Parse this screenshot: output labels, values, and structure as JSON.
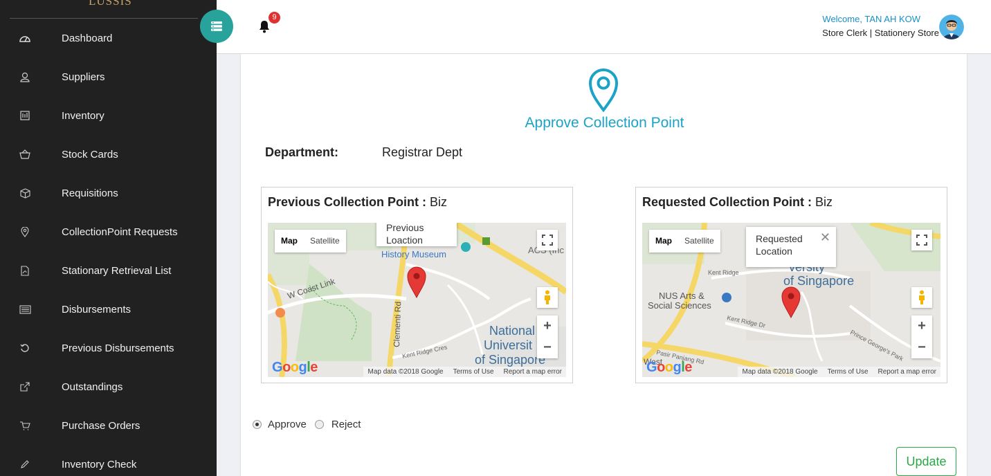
{
  "brand": "LUSSIS",
  "sidebar": {
    "items": [
      {
        "label": "Dashboard",
        "icon": "dashboard-icon"
      },
      {
        "label": "Suppliers",
        "icon": "user-icon"
      },
      {
        "label": "Inventory",
        "icon": "inventory-icon"
      },
      {
        "label": "Stock Cards",
        "icon": "basket-icon"
      },
      {
        "label": "Requisitions",
        "icon": "box-icon"
      },
      {
        "label": "CollectionPoint Requests",
        "icon": "location-icon"
      },
      {
        "label": "Stationary Retrieval List",
        "icon": "pdf-icon"
      },
      {
        "label": "Disbursements",
        "icon": "list-icon"
      },
      {
        "label": "Previous Disbursements",
        "icon": "history-icon"
      },
      {
        "label": "Outstandings",
        "icon": "external-link-icon"
      },
      {
        "label": "Purchase Orders",
        "icon": "cart-icon"
      },
      {
        "label": "Inventory Check",
        "icon": "pencil-icon"
      }
    ]
  },
  "header": {
    "notification_count": "9",
    "welcome": "Welcome, TAN AH KOW",
    "role": "Store Clerk | Stationery Store"
  },
  "main": {
    "title": "Approve Collection Point",
    "department_label": "Department:",
    "department_value": "Registrar Dept",
    "previous": {
      "label": "Previous Collection Point :",
      "value": "Biz",
      "info_window": "Previous Loaction",
      "map_labels": [
        "History Museum",
        "W Coast Link",
        "Clementi Rd",
        "Kent Ridge Cres",
        "National University of Singapore",
        "ACS (Inc"
      ]
    },
    "requested": {
      "label": "Requested Collection Point :",
      "value": "Biz",
      "info_window": "Requested Location",
      "map_labels": [
        "National University of Singapore",
        "NUS Arts & Social Sciences",
        "Kent Ridge Dr",
        "Pasir Panjang Rd",
        "Prince George's Park",
        "Kent Ridge",
        "West"
      ]
    },
    "map_controls": {
      "map": "Map",
      "satellite": "Satellite",
      "zoom_in": "+",
      "zoom_out": "−",
      "google": "Google",
      "attribution": [
        "Map data ©2018 Google",
        "Terms of Use",
        "Report a map error"
      ]
    },
    "decision": {
      "approve": "Approve",
      "reject": "Reject",
      "selected": "Approve"
    },
    "update_button": "Update"
  },
  "colors": {
    "sidebar_bg": "#212121",
    "accent_teal": "#28a39b",
    "title_blue": "#1ba3c6",
    "update_green": "#28a745",
    "marker_red": "#e53935"
  }
}
